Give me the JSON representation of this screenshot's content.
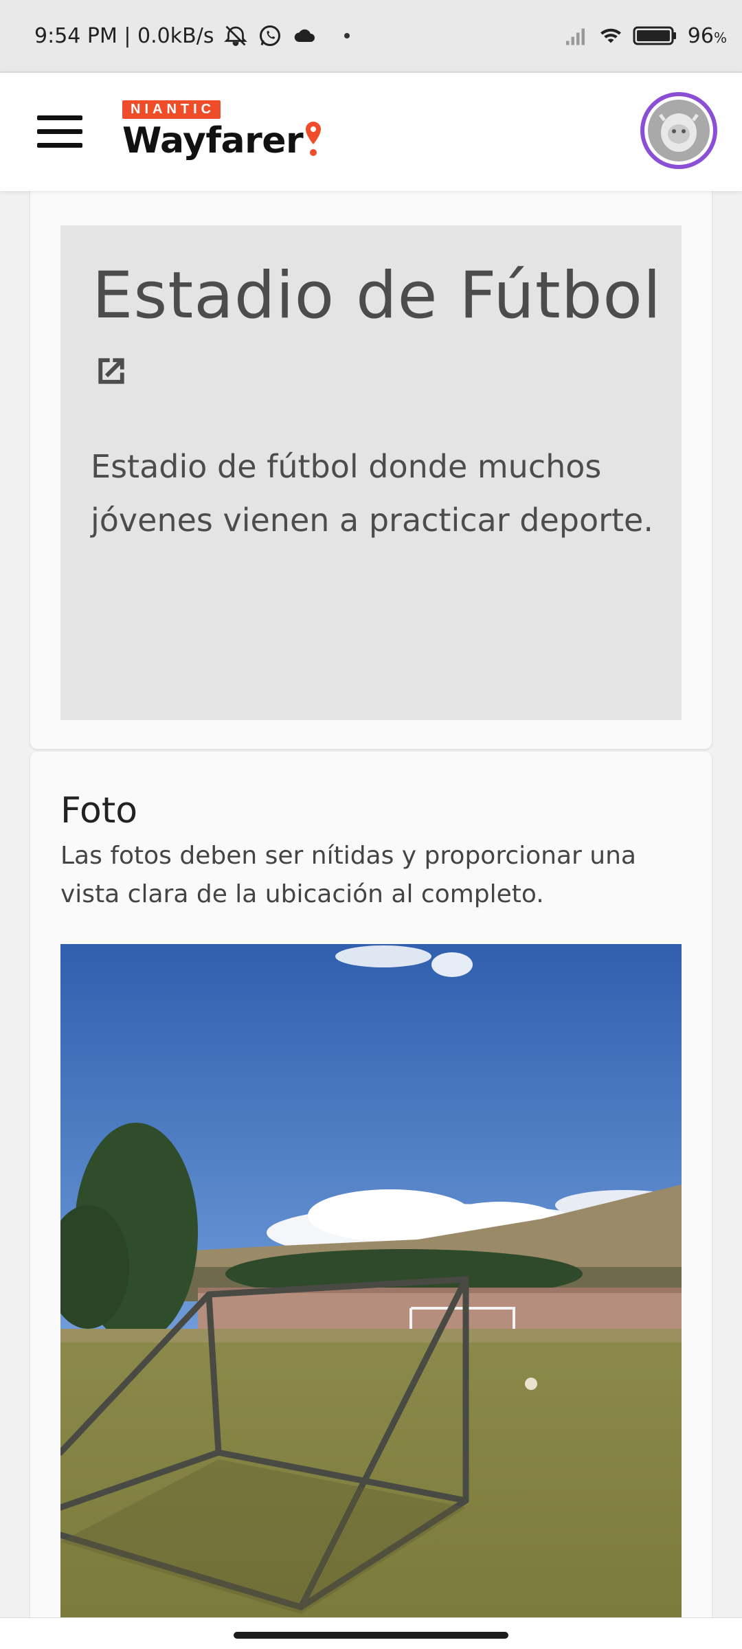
{
  "status_bar": {
    "time_speed": "9:54 PM | 0.0kB/s",
    "battery": "96",
    "battery_unit": "%",
    "icons": [
      "alarm-off-icon",
      "whatsapp-icon",
      "cloud-icon",
      "signal-icon",
      "wifi-icon",
      "battery-icon"
    ]
  },
  "header": {
    "brand_badge": "NIANTIC",
    "brand_name": "Wayfarer",
    "accent_color": "#ef4d2a",
    "avatar_ring_color": "#8b4fd6"
  },
  "poi": {
    "title": "Estadio de Fútbol",
    "description": "Estadio de fútbol donde muchos jóvenes vienen a practicar deporte."
  },
  "photo_section": {
    "title": "Foto",
    "description": "Las fotos deben ser nítidas y proporcionar una vista clara de la ubicación al completo."
  }
}
